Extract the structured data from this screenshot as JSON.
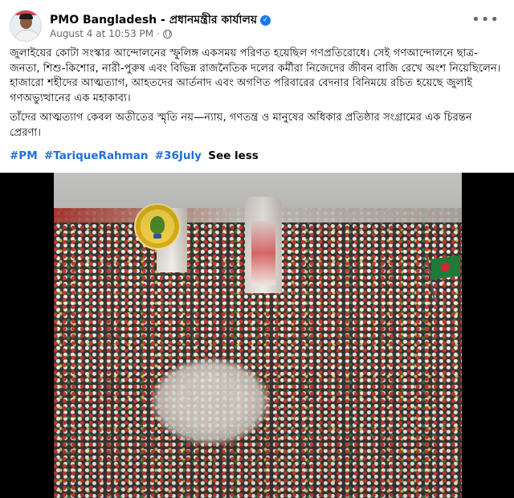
{
  "post": {
    "page_name": "PMO Bangladesh - প্রধানমন্ত্রীর কার্যালয়",
    "timestamp": "August 4 at 10:53 PM",
    "separator": "·",
    "verified_glyph": "✓",
    "more_glyph": "•••",
    "paragraphs": [
      "জুলাইয়ের কোটা সংস্কার আন্দোলনের স্ফুলিঙ্গ একসময় পরিণত হয়েছিল গণপ্রতিরোধে। সেই গণআন্দোলনে ছাত্র-জনতা, শিশু-কিশোর, নারী-পুরুষ এবং বিভিন্ন রাজনৈতিক দলের কর্মীরা নিজেদের জীবন বাজি রেখে অংশ নিয়েছিলেন। হাজারো শহীদের আত্মত্যাগ, আহতদের আর্তনাদ এবং অগণিত পরিবারের বেদনার বিনিময়ে রচিত হয়েছে জুলাই গণঅভ্যুত্থানের এক মহাকাব্য।",
      "তাঁদের আত্মত্যাগ কেবল অতীতের স্মৃতি নয়—ন্যায়, গণতন্ত্র ও মানুষের অধিকার প্রতিষ্ঠার সংগ্রামের এক চিরন্তন প্রেরণা।"
    ],
    "hashtags": [
      "#PM",
      "#TariqueRahman",
      "#36July"
    ],
    "see_less": "See less"
  },
  "icons": {
    "verified": "verified-badge-icon",
    "globe": "globe-icon",
    "more": "more-options-icon"
  },
  "colors": {
    "link_blue": "#216fdb",
    "verified_blue": "#1877f2",
    "meta_gray": "#65676b"
  }
}
